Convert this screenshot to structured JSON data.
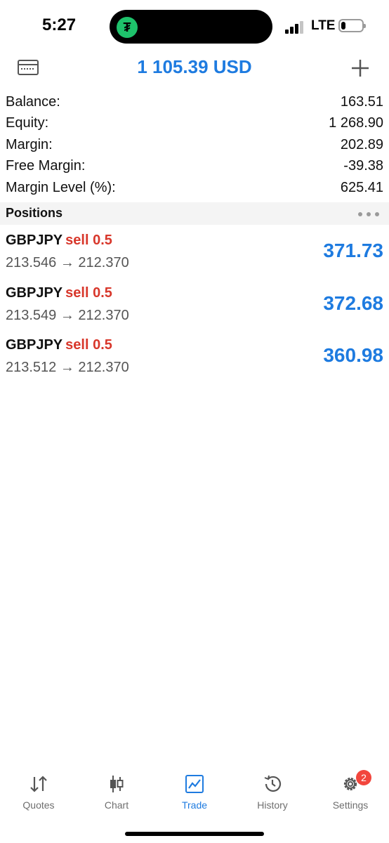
{
  "status_bar": {
    "time": "5:27",
    "network": "LTE",
    "signal_bars_active": 3,
    "battery_level": 0.2,
    "island_app_glyph": "₮",
    "island_app_color": "#1ec26b"
  },
  "header": {
    "title": "1 105.39 USD",
    "left_icon": "card-icon",
    "right_icon": "plus-icon",
    "accent_color": "#1e7be0"
  },
  "summary": [
    {
      "label": "Balance:",
      "value": "163.51"
    },
    {
      "label": "Equity:",
      "value": "1 268.90"
    },
    {
      "label": "Margin:",
      "value": "202.89"
    },
    {
      "label": "Free Margin:",
      "value": "-39.38"
    },
    {
      "label": "Margin Level (%):",
      "value": "625.41"
    }
  ],
  "positions": {
    "title": "Positions",
    "items": [
      {
        "symbol": "GBPJPY",
        "side": "sell 0.5",
        "prices": "213.546 → 212.370",
        "profit": "371.73"
      },
      {
        "symbol": "GBPJPY",
        "side": "sell 0.5",
        "prices": "213.549 → 212.370",
        "profit": "372.68"
      },
      {
        "symbol": "GBPJPY",
        "side": "sell 0.5",
        "prices": "213.512 → 212.370",
        "profit": "360.98"
      }
    ],
    "sell_color": "#d8372b",
    "profit_color": "#1e7be0"
  },
  "tabs": [
    {
      "label": "Quotes",
      "icon": "quotes-icon"
    },
    {
      "label": "Chart",
      "icon": "chart-icon"
    },
    {
      "label": "Trade",
      "icon": "trade-icon",
      "active": true
    },
    {
      "label": "History",
      "icon": "history-icon"
    },
    {
      "label": "Settings",
      "icon": "settings-icon",
      "badge": "2"
    }
  ]
}
